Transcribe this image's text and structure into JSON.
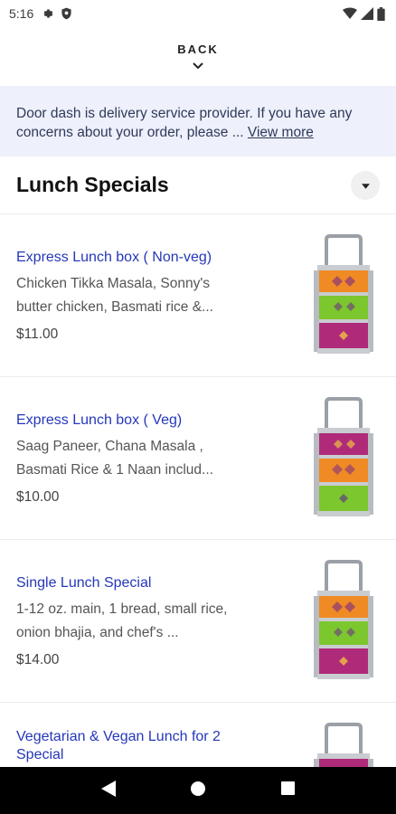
{
  "status_bar": {
    "time": "5:16"
  },
  "back": {
    "label": "BACK"
  },
  "notice": {
    "text": "Door dash is delivery service provider. If you have any  concerns about your order, please ...",
    "link": "View more"
  },
  "section": {
    "title": "Lunch Specials"
  },
  "items": [
    {
      "name": "Express Lunch box ( Non-veg)",
      "desc": "Chicken Tikka Masala, Sonny's butter chicken, Basmati rice &...",
      "price": "$11.00"
    },
    {
      "name": "Express Lunch box ( Veg)",
      "desc": "Saag Paneer, Chana Masala , Basmati Rice & 1 Naan includ...",
      "price": "$10.00"
    },
    {
      "name": "Single Lunch Special",
      "desc": "1-12 oz. main, 1 bread, small rice, onion bhajia, and chef's ...",
      "price": "$14.00"
    },
    {
      "name": "Vegetarian & Vegan Lunch for 2 Special"
    }
  ],
  "colors": {
    "link_blue": "#2537b8",
    "notice_bg": "#eef0fb",
    "tiffin_orange": "#f08a24",
    "tiffin_green": "#7cc62e",
    "tiffin_magenta": "#b02a7a"
  },
  "icons": [
    "gear-icon",
    "shield-icon",
    "wifi-icon",
    "signal-icon",
    "battery-icon",
    "chevron-down-icon",
    "caret-down-icon",
    "back-triangle-icon",
    "home-circle-icon",
    "recents-square-icon"
  ]
}
